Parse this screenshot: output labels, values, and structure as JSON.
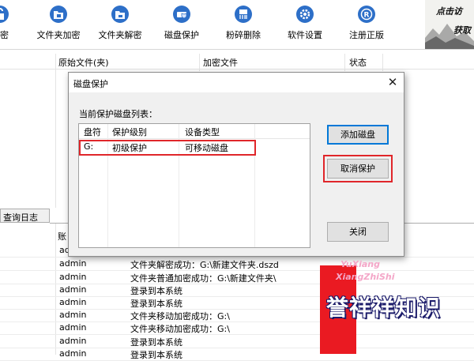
{
  "toolbar": {
    "buttons": [
      {
        "label": "解密",
        "icon": "unlock-icon"
      },
      {
        "label": "文件夹加密",
        "icon": "folder-lock-icon"
      },
      {
        "label": "文件夹解密",
        "icon": "folder-unlock-icon"
      },
      {
        "label": "磁盘保护",
        "icon": "disk-shield-icon"
      },
      {
        "label": "粉碎删除",
        "icon": "shred-icon"
      },
      {
        "label": "软件设置",
        "icon": "gear-icon"
      },
      {
        "label": "注册正版",
        "icon": "registered-icon"
      }
    ],
    "brand_line1": "点击访",
    "brand_line2": "获取"
  },
  "file_table": {
    "columns": [
      "原始文件(夹)",
      "加密文件",
      "状态"
    ]
  },
  "log_tab": "查询日志",
  "log_table": {
    "account_header": "账",
    "rows": [
      {
        "account": "ad",
        "message": ""
      },
      {
        "account": "admin",
        "message": "文件夹解密成功：G:\\新建文件夹.dszd"
      },
      {
        "account": "admin",
        "message": "文件夹普通加密成功：G:\\新建文件夹\\"
      },
      {
        "account": "admin",
        "message": "登录到本系统"
      },
      {
        "account": "admin",
        "message": "登录到本系统"
      },
      {
        "account": "admin",
        "message": "文件夹移动加密成功：G:\\"
      },
      {
        "account": "admin",
        "message": "文件夹移动加密成功：G:\\"
      },
      {
        "account": "admin",
        "message": "登录到本系统"
      },
      {
        "account": "admin",
        "message": "登录到本系统"
      }
    ]
  },
  "dialog": {
    "title": "磁盘保护",
    "close_symbol": "✕",
    "caption": "当前保护磁盘列表：",
    "columns": [
      "盘符",
      "保护级别",
      "设备类型"
    ],
    "rows": [
      {
        "drive": "G:",
        "level": "初级保护",
        "type": "可移动磁盘"
      }
    ],
    "add_button": "添加磁盘",
    "cancel_button": "取消保护",
    "close_button": "关闭",
    "highlight_color": "#e0262a"
  },
  "watermark": {
    "pinyin_line1": "YuXiang",
    "pinyin_line2": "XiangZhiShi",
    "text": "誉祥祥知识",
    "red": "#ea1a22",
    "navy": "#1b1b6a"
  }
}
